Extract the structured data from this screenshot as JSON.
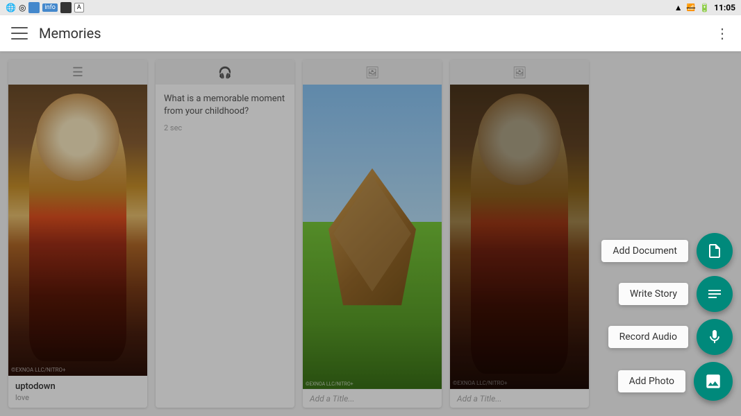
{
  "statusBar": {
    "time": "11:05",
    "icons": [
      "wifi",
      "signal-off",
      "battery"
    ]
  },
  "appBar": {
    "title": "Memories",
    "menuIcon": "menu",
    "moreIcon": "more-vertical"
  },
  "cards": [
    {
      "id": "card-1",
      "type": "image",
      "headerIcon": "text",
      "name": "uptodown",
      "subtitle": "love",
      "hasImage": true
    },
    {
      "id": "card-2",
      "type": "text",
      "headerIcon": "headphone",
      "question": "What is a memorable moment from your childhood?",
      "duration": "2 sec"
    },
    {
      "id": "card-3",
      "type": "image",
      "headerIcon": "image",
      "titlePlaceholder": "Add a Title...",
      "hasImage": true
    },
    {
      "id": "card-4",
      "type": "image",
      "headerIcon": "image",
      "titlePlaceholder": "Add a Title...",
      "hasImage": true
    }
  ],
  "fabMenu": {
    "items": [
      {
        "id": "add-document",
        "label": "Add Document",
        "icon": "document"
      },
      {
        "id": "write-story",
        "label": "Write Story",
        "icon": "text-lines"
      },
      {
        "id": "record-audio",
        "label": "Record Audio",
        "icon": "microphone"
      },
      {
        "id": "add-photo",
        "label": "Add Photo",
        "icon": "image-frame"
      }
    ]
  }
}
